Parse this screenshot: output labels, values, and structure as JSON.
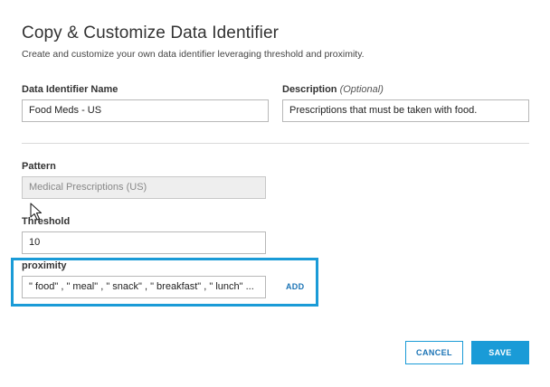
{
  "dialog": {
    "title": "Copy & Customize Data Identifier",
    "subtitle": "Create and customize your own data identifier leveraging threshold and proximity."
  },
  "name_field": {
    "label": "Data Identifier Name",
    "value": "Food Meds - US"
  },
  "description_field": {
    "label": "Description",
    "optional_label": "(Optional)",
    "value": "Prescriptions that must be taken with food."
  },
  "pattern_field": {
    "label": "Pattern",
    "value": "Medical Prescriptions (US)"
  },
  "threshold_field": {
    "label": "Threshold",
    "value": "10"
  },
  "proximity_field": {
    "label": "proximity",
    "value": "\" food\" , \" meal\" , \" snack\" , \" breakfast\" , \" lunch\" ...",
    "add_label": "ADD"
  },
  "buttons": {
    "cancel_label": "CANCEL",
    "save_label": "SAVE"
  },
  "colors": {
    "accent": "#1a9bd7",
    "link": "#1a73b5"
  }
}
